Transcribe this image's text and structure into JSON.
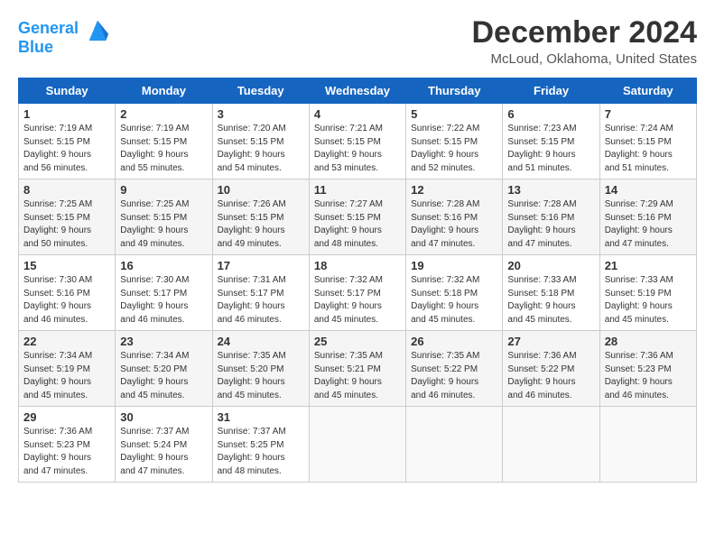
{
  "header": {
    "logo_line1": "General",
    "logo_line2": "Blue",
    "title": "December 2024",
    "location": "McLoud, Oklahoma, United States"
  },
  "weekdays": [
    "Sunday",
    "Monday",
    "Tuesday",
    "Wednesday",
    "Thursday",
    "Friday",
    "Saturday"
  ],
  "weeks": [
    [
      {
        "day": 1,
        "info": "Sunrise: 7:19 AM\nSunset: 5:15 PM\nDaylight: 9 hours\nand 56 minutes."
      },
      {
        "day": 2,
        "info": "Sunrise: 7:19 AM\nSunset: 5:15 PM\nDaylight: 9 hours\nand 55 minutes."
      },
      {
        "day": 3,
        "info": "Sunrise: 7:20 AM\nSunset: 5:15 PM\nDaylight: 9 hours\nand 54 minutes."
      },
      {
        "day": 4,
        "info": "Sunrise: 7:21 AM\nSunset: 5:15 PM\nDaylight: 9 hours\nand 53 minutes."
      },
      {
        "day": 5,
        "info": "Sunrise: 7:22 AM\nSunset: 5:15 PM\nDaylight: 9 hours\nand 52 minutes."
      },
      {
        "day": 6,
        "info": "Sunrise: 7:23 AM\nSunset: 5:15 PM\nDaylight: 9 hours\nand 51 minutes."
      },
      {
        "day": 7,
        "info": "Sunrise: 7:24 AM\nSunset: 5:15 PM\nDaylight: 9 hours\nand 51 minutes."
      }
    ],
    [
      {
        "day": 8,
        "info": "Sunrise: 7:25 AM\nSunset: 5:15 PM\nDaylight: 9 hours\nand 50 minutes."
      },
      {
        "day": 9,
        "info": "Sunrise: 7:25 AM\nSunset: 5:15 PM\nDaylight: 9 hours\nand 49 minutes."
      },
      {
        "day": 10,
        "info": "Sunrise: 7:26 AM\nSunset: 5:15 PM\nDaylight: 9 hours\nand 49 minutes."
      },
      {
        "day": 11,
        "info": "Sunrise: 7:27 AM\nSunset: 5:15 PM\nDaylight: 9 hours\nand 48 minutes."
      },
      {
        "day": 12,
        "info": "Sunrise: 7:28 AM\nSunset: 5:16 PM\nDaylight: 9 hours\nand 47 minutes."
      },
      {
        "day": 13,
        "info": "Sunrise: 7:28 AM\nSunset: 5:16 PM\nDaylight: 9 hours\nand 47 minutes."
      },
      {
        "day": 14,
        "info": "Sunrise: 7:29 AM\nSunset: 5:16 PM\nDaylight: 9 hours\nand 47 minutes."
      }
    ],
    [
      {
        "day": 15,
        "info": "Sunrise: 7:30 AM\nSunset: 5:16 PM\nDaylight: 9 hours\nand 46 minutes."
      },
      {
        "day": 16,
        "info": "Sunrise: 7:30 AM\nSunset: 5:17 PM\nDaylight: 9 hours\nand 46 minutes."
      },
      {
        "day": 17,
        "info": "Sunrise: 7:31 AM\nSunset: 5:17 PM\nDaylight: 9 hours\nand 46 minutes."
      },
      {
        "day": 18,
        "info": "Sunrise: 7:32 AM\nSunset: 5:17 PM\nDaylight: 9 hours\nand 45 minutes."
      },
      {
        "day": 19,
        "info": "Sunrise: 7:32 AM\nSunset: 5:18 PM\nDaylight: 9 hours\nand 45 minutes."
      },
      {
        "day": 20,
        "info": "Sunrise: 7:33 AM\nSunset: 5:18 PM\nDaylight: 9 hours\nand 45 minutes."
      },
      {
        "day": 21,
        "info": "Sunrise: 7:33 AM\nSunset: 5:19 PM\nDaylight: 9 hours\nand 45 minutes."
      }
    ],
    [
      {
        "day": 22,
        "info": "Sunrise: 7:34 AM\nSunset: 5:19 PM\nDaylight: 9 hours\nand 45 minutes."
      },
      {
        "day": 23,
        "info": "Sunrise: 7:34 AM\nSunset: 5:20 PM\nDaylight: 9 hours\nand 45 minutes."
      },
      {
        "day": 24,
        "info": "Sunrise: 7:35 AM\nSunset: 5:20 PM\nDaylight: 9 hours\nand 45 minutes."
      },
      {
        "day": 25,
        "info": "Sunrise: 7:35 AM\nSunset: 5:21 PM\nDaylight: 9 hours\nand 45 minutes."
      },
      {
        "day": 26,
        "info": "Sunrise: 7:35 AM\nSunset: 5:22 PM\nDaylight: 9 hours\nand 46 minutes."
      },
      {
        "day": 27,
        "info": "Sunrise: 7:36 AM\nSunset: 5:22 PM\nDaylight: 9 hours\nand 46 minutes."
      },
      {
        "day": 28,
        "info": "Sunrise: 7:36 AM\nSunset: 5:23 PM\nDaylight: 9 hours\nand 46 minutes."
      }
    ],
    [
      {
        "day": 29,
        "info": "Sunrise: 7:36 AM\nSunset: 5:23 PM\nDaylight: 9 hours\nand 47 minutes."
      },
      {
        "day": 30,
        "info": "Sunrise: 7:37 AM\nSunset: 5:24 PM\nDaylight: 9 hours\nand 47 minutes."
      },
      {
        "day": 31,
        "info": "Sunrise: 7:37 AM\nSunset: 5:25 PM\nDaylight: 9 hours\nand 48 minutes."
      },
      null,
      null,
      null,
      null
    ]
  ]
}
